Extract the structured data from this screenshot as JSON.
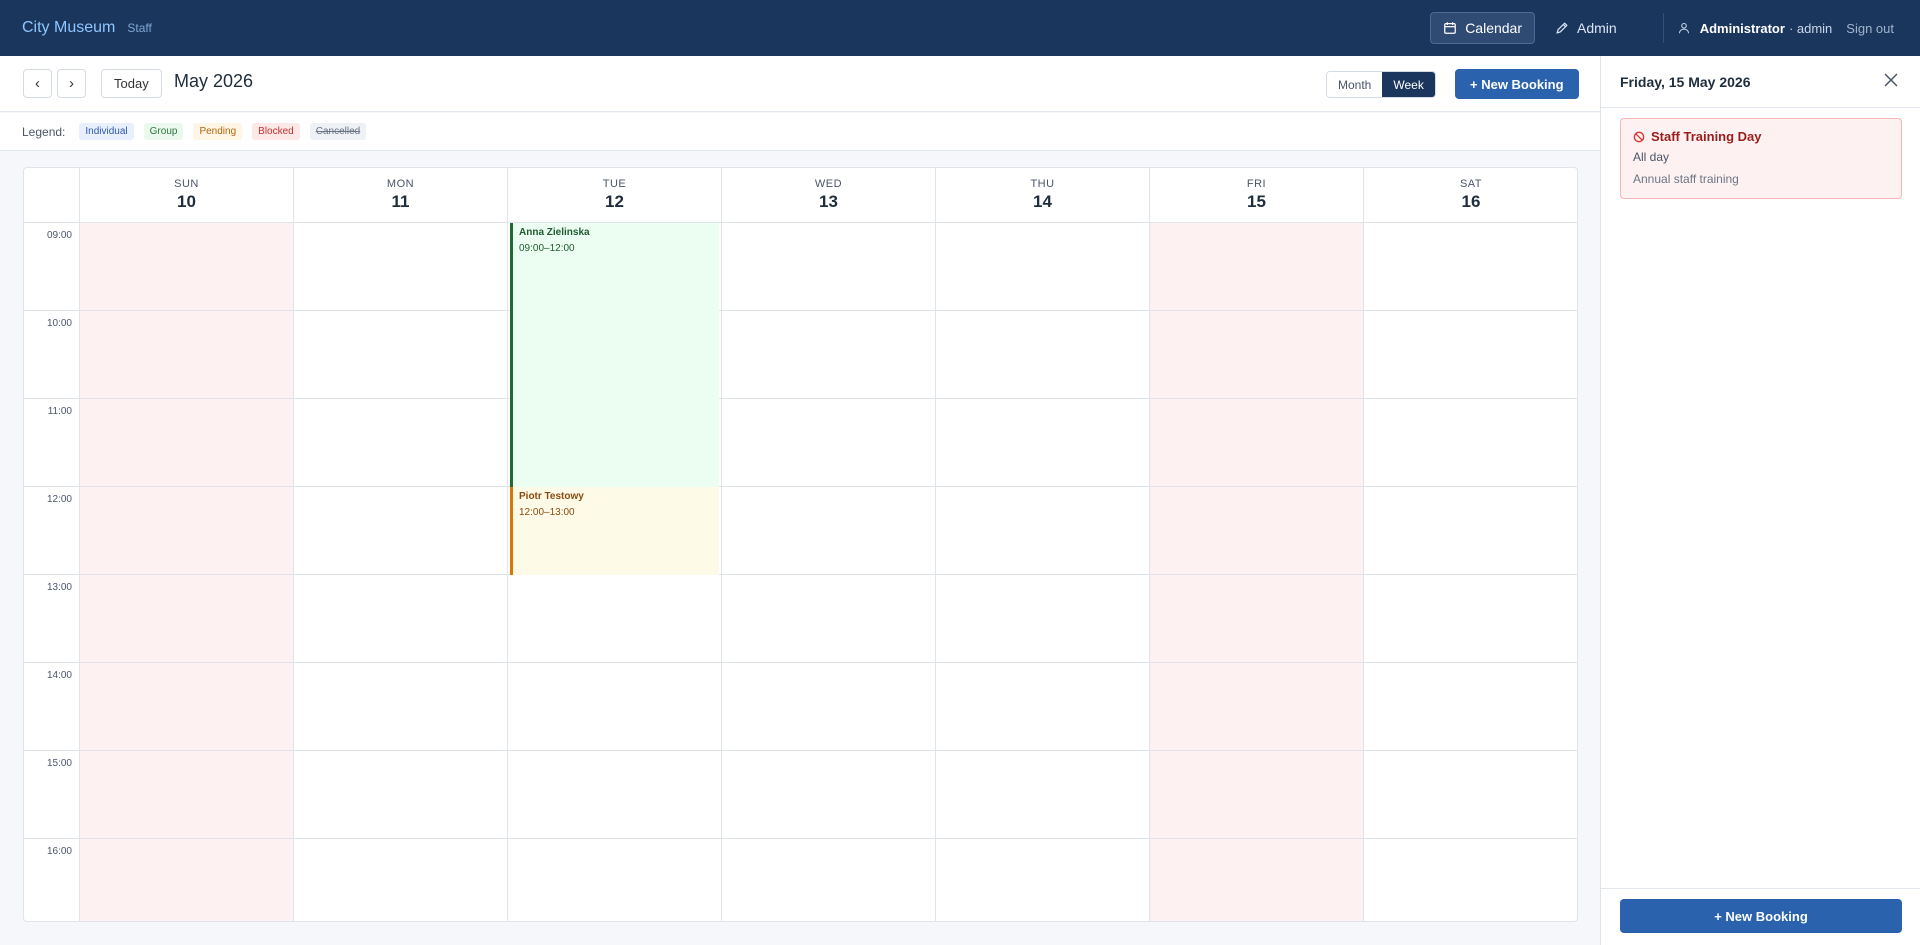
{
  "header": {
    "brand": "City Museum",
    "brand_sub": "Staff",
    "nav": [
      {
        "label": "Calendar",
        "icon": "calendar-icon",
        "active": true
      },
      {
        "label": "Admin",
        "icon": "pencil-icon",
        "active": false
      }
    ],
    "user_name": "Administrator",
    "user_role": "· admin",
    "signout": "Sign out"
  },
  "toolbar": {
    "prev": "‹",
    "next": "›",
    "today": "Today",
    "period": "May 2026",
    "views": [
      "Month",
      "Week"
    ],
    "active_view": "Week",
    "new_booking": "+ New Booking"
  },
  "legend": {
    "label": "Legend:",
    "items": [
      "Individual",
      "Group",
      "Pending",
      "Blocked",
      "Cancelled"
    ]
  },
  "calendar": {
    "days": [
      {
        "dow": "SUN",
        "num": "10",
        "blocked": true
      },
      {
        "dow": "MON",
        "num": "11",
        "blocked": false
      },
      {
        "dow": "TUE",
        "num": "12",
        "blocked": false
      },
      {
        "dow": "WED",
        "num": "13",
        "blocked": false
      },
      {
        "dow": "THU",
        "num": "14",
        "blocked": false
      },
      {
        "dow": "FRI",
        "num": "15",
        "blocked": true
      },
      {
        "dow": "SAT",
        "num": "16",
        "blocked": false
      }
    ],
    "hours": [
      "09:00",
      "10:00",
      "11:00",
      "12:00",
      "13:00",
      "14:00",
      "15:00",
      "16:00"
    ],
    "events": [
      {
        "name": "Anna Zielinska",
        "time": "09:00–12:00",
        "type": "group"
      },
      {
        "name": "Piotr Testowy",
        "time": "12:00–13:00",
        "type": "pending"
      }
    ]
  },
  "side_panel": {
    "title": "Friday, 15 May 2026",
    "card": {
      "title": "Staff Training Day",
      "when": "All day",
      "desc": "Annual staff training"
    },
    "new_booking": "+ New Booking"
  },
  "colors": {
    "header_bg": "#1b365d",
    "primary": "#2a62ad",
    "blocked_bg": "#fef1f1",
    "group": "#1f6b36",
    "pending": "#d97706"
  }
}
